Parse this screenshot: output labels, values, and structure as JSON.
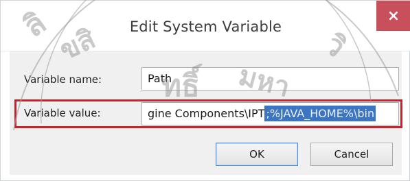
{
  "dialog": {
    "title": "Edit System Variable",
    "close_glyph": "×"
  },
  "form": {
    "variable_name_label": "Variable name:",
    "variable_name_value": "Path",
    "variable_value_label": "Variable value:",
    "variable_value_unselected": "gine Components\\IPT",
    "variable_value_selected": ";%JAVA_HOME%\\bin"
  },
  "buttons": {
    "ok": "OK",
    "cancel": "Cancel"
  },
  "watermark": {
    "text": "ลิขสิทธิ์มหาวิทยาลัยแม่โจ้"
  },
  "colors": {
    "close_bg": "#c7505a",
    "selection_bg": "#3c75c2",
    "highlight_border": "#c5242d"
  },
  "icons": {
    "close": "close-icon"
  }
}
